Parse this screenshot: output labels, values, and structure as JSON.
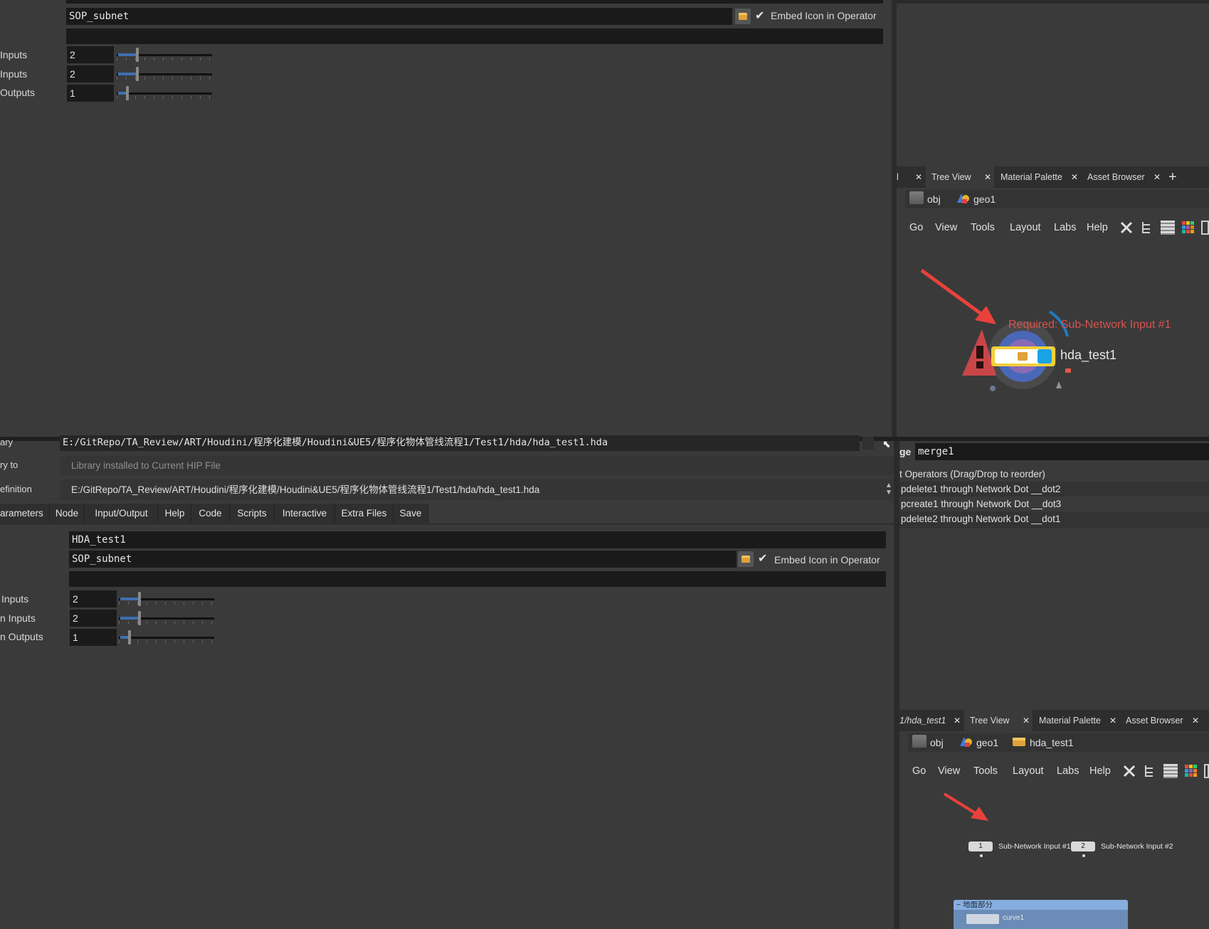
{
  "top_param": {
    "icon_field": "SOP_subnet",
    "embed_label": "Embed Icon in Operator",
    "rows": [
      {
        "label": "Inputs",
        "value": "2",
        "fraction": 0.2
      },
      {
        "label": "Inputs",
        "value": "2",
        "fraction": 0.2
      },
      {
        "label": "Outputs",
        "value": "1",
        "fraction": 0.1
      }
    ]
  },
  "top_network": {
    "tabs": [
      {
        "label": "l"
      },
      {
        "label": "Tree View"
      },
      {
        "label": "Material Palette"
      },
      {
        "label": "Asset Browser"
      }
    ],
    "add_tab": "+",
    "breadcrumb": [
      "obj",
      "geo1"
    ],
    "menu": [
      "Go",
      "View",
      "Tools",
      "Layout",
      "Labs",
      "Help"
    ],
    "node_name": "hda_test1",
    "warning": "Required: Sub-Network Input #1"
  },
  "type_properties": {
    "library_label": "ary",
    "library_path": "E:/GitRepo/TA_Review/ART/Houdini/程序化建模/Houdini&UE5/程序化物体管线流程1/Test1/hda/hda_test1.hda",
    "save_to_label": "ry to",
    "save_to_value": "Library installed to Current HIP File",
    "definition_label": "efinition",
    "definition_path": "E:/GitRepo/TA_Review/ART/Houdini/程序化建模/Houdini&UE5/程序化物体管线流程1/Test1/hda/hda_test1.hda",
    "tabs": [
      "arameters",
      "Node",
      "Input/Output",
      "Help",
      "Code",
      "Scripts",
      "Interactive",
      "Extra Files",
      "Save"
    ],
    "label_field": "HDA_test1",
    "icon_field": "SOP_subnet",
    "embed_label": "Embed Icon in Operator",
    "rows": [
      {
        "label": "Inputs",
        "value": "2",
        "fraction": 0.2
      },
      {
        "label": "n Inputs",
        "value": "2",
        "fraction": 0.2
      },
      {
        "label": "n Outputs",
        "value": "1",
        "fraction": 0.1
      }
    ]
  },
  "merge_panel": {
    "label": "ge",
    "name": "merge1",
    "header": "t Operators (Drag/Drop to reorder)",
    "items": [
      "pdelete1 through Network Dot __dot2",
      "pcreate1 through Network Dot __dot3",
      "pdelete2 through Network Dot __dot1"
    ]
  },
  "bottom_network": {
    "tabs": [
      {
        "label": "1/hda_test1"
      },
      {
        "label": "Tree View"
      },
      {
        "label": "Material Palette"
      },
      {
        "label": "Asset Browser"
      }
    ],
    "breadcrumb": [
      "obj",
      "geo1",
      "hda_test1"
    ],
    "menu": [
      "Go",
      "View",
      "Tools",
      "Layout",
      "Labs",
      "Help"
    ],
    "inputs": [
      {
        "number": "1",
        "label": "Sub-Network Input #1"
      },
      {
        "number": "2",
        "label": "Sub-Network Input #2"
      }
    ],
    "group_box_title": "地面部分",
    "group_node": "curve1"
  },
  "colors": {
    "background": "#3a3a3a",
    "field": "#1a1a1a",
    "accent_blue": "#3f6fb0",
    "annotation_red": "#e8423a",
    "warning_text": "#d9534f",
    "group_box": "#7fa6d6"
  }
}
